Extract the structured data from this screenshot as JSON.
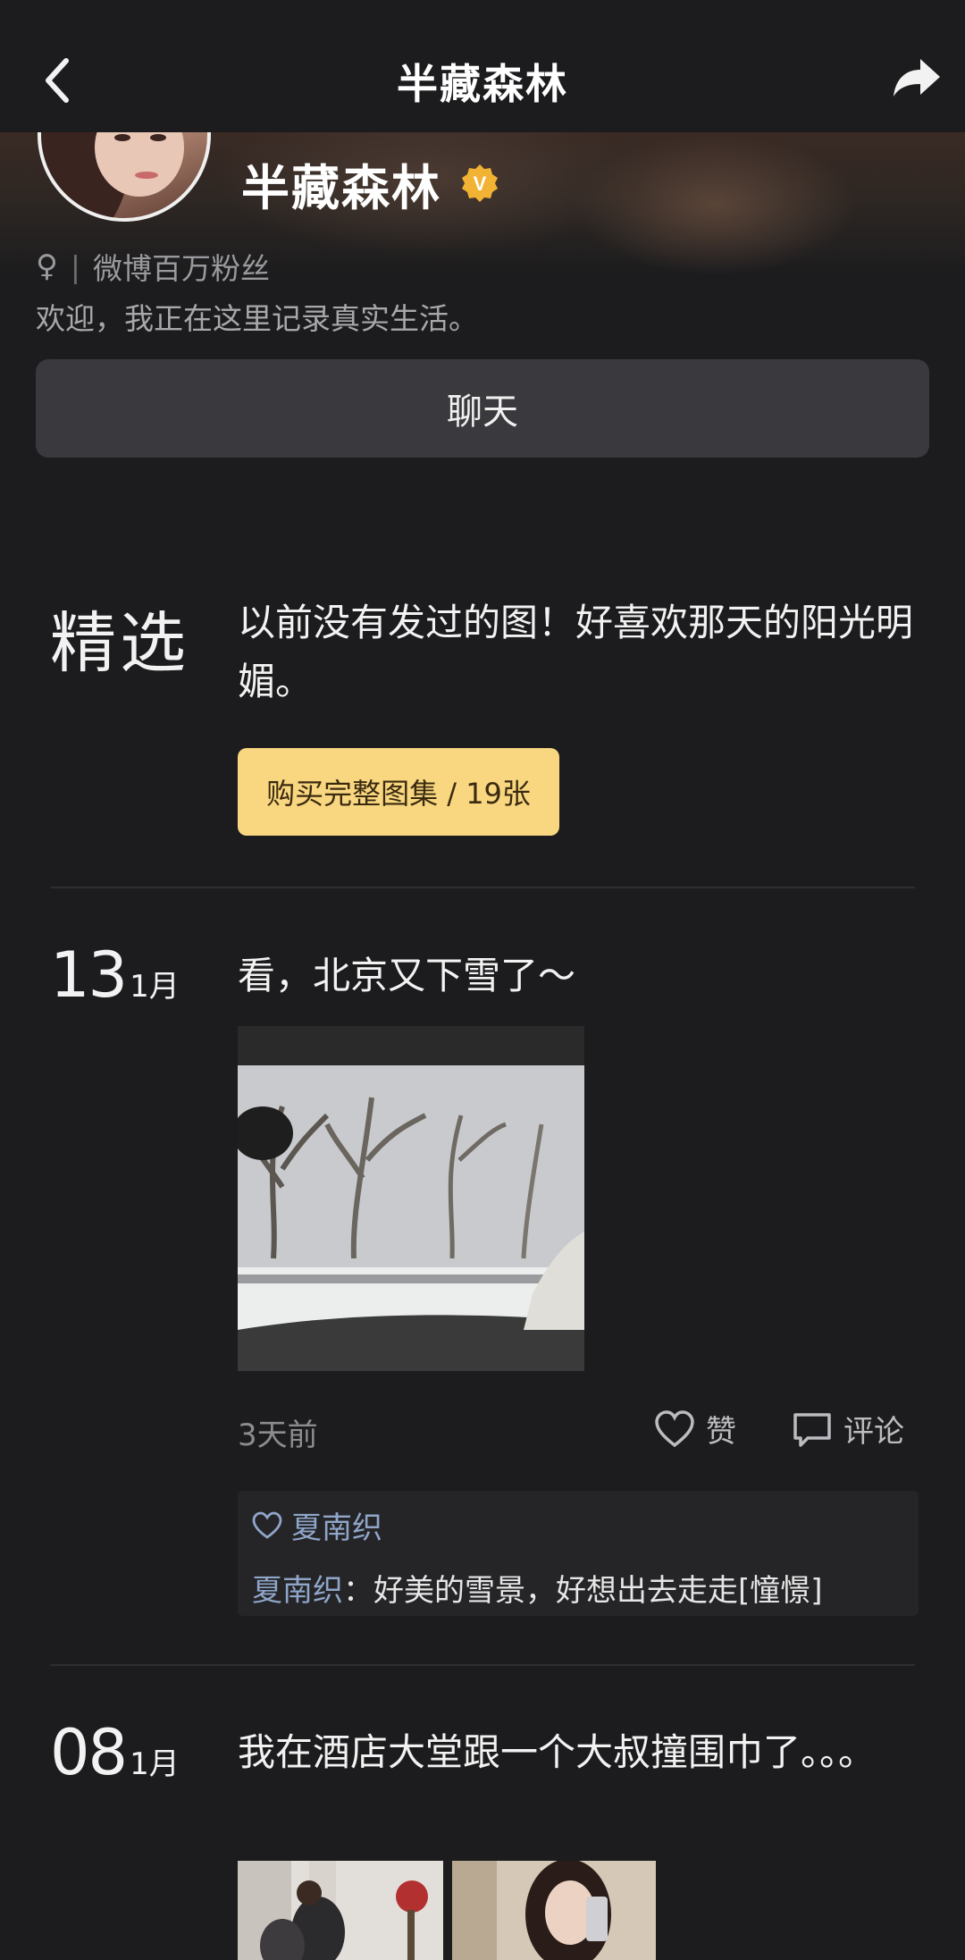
{
  "topbar": {
    "title": "半藏森林"
  },
  "profile": {
    "name": "半藏森林",
    "gender_symbol": "♀",
    "separator": "|",
    "tagline": "微博百万粉丝",
    "bio": "欢迎，我正在这里记录真实生活。",
    "verified_badge": "V"
  },
  "chat_button": {
    "label": "聊天"
  },
  "featured": {
    "label": "精选",
    "text": "以前没有发过的图！好喜欢那天的阳光明媚。",
    "buy_label": "购买完整图集 / 19张"
  },
  "posts": [
    {
      "day": "13",
      "month": "1月",
      "text": "看，北京又下雪了～",
      "time_ago": "3天前",
      "like_label": "赞",
      "comment_label": "评论",
      "liked_by": "夏南织",
      "comments": [
        {
          "author": "夏南织",
          "separator": "：",
          "text": "好美的雪景，好想出去走走[憧憬]"
        }
      ]
    },
    {
      "day": "08",
      "month": "1月",
      "text": "我在酒店大堂跟一个大叔撞围巾了。。。"
    }
  ],
  "colors": {
    "background": "#1c1c1e",
    "buy_button": "#f9d780",
    "link_blue": "#8fa6c9",
    "badge_gold": "#f2b233"
  },
  "icons": [
    "back-arrow-icon",
    "share-icon",
    "verified-icon",
    "female-icon",
    "heart-icon",
    "comment-icon"
  ]
}
